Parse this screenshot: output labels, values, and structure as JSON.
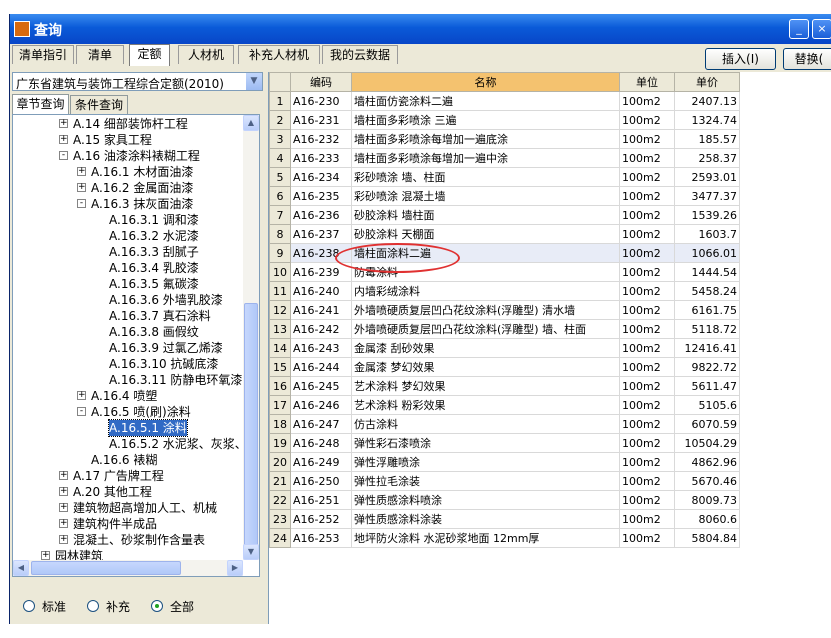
{
  "window": {
    "title": "查询",
    "controls": {
      "minimize": "_",
      "close": "×"
    }
  },
  "tabs": [
    {
      "label": "清单指引",
      "active": false
    },
    {
      "label": "清单",
      "active": false
    },
    {
      "label": "定额",
      "active": true
    },
    {
      "label": "人材机",
      "active": false
    },
    {
      "label": "补充人材机",
      "active": false
    },
    {
      "label": "我的云数据",
      "active": false
    }
  ],
  "actions": {
    "insert": "插入(I)",
    "replace": "替换("
  },
  "library": {
    "selected": "广东省建筑与装饰工程综合定额(2010)"
  },
  "subtabs": [
    {
      "label": "章节查询",
      "active": true
    },
    {
      "label": "条件查询",
      "active": false
    }
  ],
  "tree": [
    {
      "depth": 1,
      "exp": "+",
      "label": "A.14 细部装饰杆工程"
    },
    {
      "depth": 1,
      "exp": "+",
      "label": "A.15 家具工程"
    },
    {
      "depth": 1,
      "exp": "-",
      "label": "A.16 油漆涂料裱糊工程"
    },
    {
      "depth": 2,
      "exp": "+",
      "label": "A.16.1 木材面油漆"
    },
    {
      "depth": 2,
      "exp": "+",
      "label": "A.16.2 金属面油漆"
    },
    {
      "depth": 2,
      "exp": "-",
      "label": "A.16.3 抹灰面油漆"
    },
    {
      "depth": 3,
      "exp": "",
      "label": "A.16.3.1 调和漆"
    },
    {
      "depth": 3,
      "exp": "",
      "label": "A.16.3.2 水泥漆"
    },
    {
      "depth": 3,
      "exp": "",
      "label": "A.16.3.3 刮腻子"
    },
    {
      "depth": 3,
      "exp": "",
      "label": "A.16.3.4 乳胶漆"
    },
    {
      "depth": 3,
      "exp": "",
      "label": "A.16.3.5 氟碳漆"
    },
    {
      "depth": 3,
      "exp": "",
      "label": "A.16.3.6 外墙乳胶漆"
    },
    {
      "depth": 3,
      "exp": "",
      "label": "A.16.3.7 真石涂料"
    },
    {
      "depth": 3,
      "exp": "",
      "label": "A.16.3.8 画假纹"
    },
    {
      "depth": 3,
      "exp": "",
      "label": "A.16.3.9 过氯乙烯漆"
    },
    {
      "depth": 3,
      "exp": "",
      "label": "A.16.3.10 抗碱底漆"
    },
    {
      "depth": 3,
      "exp": "",
      "label": "A.16.3.11 防静电环氧漆"
    },
    {
      "depth": 2,
      "exp": "+",
      "label": "A.16.4 喷塑"
    },
    {
      "depth": 2,
      "exp": "-",
      "label": "A.16.5 喷(刷)涂料"
    },
    {
      "depth": 3,
      "exp": "",
      "label": "A.16.5.1 涂料",
      "selected": true
    },
    {
      "depth": 3,
      "exp": "",
      "label": "A.16.5.2 水泥浆、灰浆、大"
    },
    {
      "depth": 2,
      "exp": "",
      "label": "A.16.6 裱糊"
    },
    {
      "depth": 1,
      "exp": "+",
      "label": "A.17 广告牌工程"
    },
    {
      "depth": 1,
      "exp": "+",
      "label": "A.20 其他工程"
    },
    {
      "depth": 1,
      "exp": "+",
      "label": "建筑物超高增加人工、机械"
    },
    {
      "depth": 1,
      "exp": "+",
      "label": "建筑构件半成品"
    },
    {
      "depth": 1,
      "exp": "+",
      "label": "混凝土、砂浆制作含量表"
    },
    {
      "depth": 0,
      "exp": "+",
      "label": "园林建筑"
    }
  ],
  "filters": [
    {
      "label": "标准",
      "checked": false
    },
    {
      "label": "补充",
      "checked": false
    },
    {
      "label": "全部",
      "checked": true
    }
  ],
  "table": {
    "headers": {
      "code": "编码",
      "name": "名称",
      "unit": "单位",
      "price": "单价"
    },
    "rows": [
      {
        "n": "1",
        "code": "A16-230",
        "name": "墙柱面仿瓷涂料二遍",
        "unit": "100m2",
        "price": "2407.13"
      },
      {
        "n": "2",
        "code": "A16-231",
        "name": "墙柱面多彩喷涂 三遍",
        "unit": "100m2",
        "price": "1324.74"
      },
      {
        "n": "3",
        "code": "A16-232",
        "name": "墙柱面多彩喷涂每增加一遍底涂",
        "unit": "100m2",
        "price": "185.57"
      },
      {
        "n": "4",
        "code": "A16-233",
        "name": "墙柱面多彩喷涂每增加一遍中涂",
        "unit": "100m2",
        "price": "258.37"
      },
      {
        "n": "5",
        "code": "A16-234",
        "name": "彩砂喷涂 墙、柱面",
        "unit": "100m2",
        "price": "2593.01"
      },
      {
        "n": "6",
        "code": "A16-235",
        "name": "彩砂喷涂 混凝土墙",
        "unit": "100m2",
        "price": "3477.37"
      },
      {
        "n": "7",
        "code": "A16-236",
        "name": "砂胶涂料 墙柱面",
        "unit": "100m2",
        "price": "1539.26"
      },
      {
        "n": "8",
        "code": "A16-237",
        "name": "砂胶涂料 天棚面",
        "unit": "100m2",
        "price": "1603.7"
      },
      {
        "n": "9",
        "code": "A16-238",
        "name": "墙柱面涂料二遍",
        "unit": "100m2",
        "price": "1066.01",
        "highlight": true
      },
      {
        "n": "10",
        "code": "A16-239",
        "name": "防霉涂料",
        "unit": "100m2",
        "price": "1444.54"
      },
      {
        "n": "11",
        "code": "A16-240",
        "name": "内墙彩绒涂料",
        "unit": "100m2",
        "price": "5458.24"
      },
      {
        "n": "12",
        "code": "A16-241",
        "name": "外墙喷硬质复层凹凸花纹涂料(浮雕型) 清水墙",
        "unit": "100m2",
        "price": "6161.75"
      },
      {
        "n": "13",
        "code": "A16-242",
        "name": "外墙喷硬质复层凹凸花纹涂料(浮雕型) 墙、柱面",
        "unit": "100m2",
        "price": "5118.72"
      },
      {
        "n": "14",
        "code": "A16-243",
        "name": "金属漆 刮砂效果",
        "unit": "100m2",
        "price": "12416.41"
      },
      {
        "n": "15",
        "code": "A16-244",
        "name": "金属漆 梦幻效果",
        "unit": "100m2",
        "price": "9822.72"
      },
      {
        "n": "16",
        "code": "A16-245",
        "name": "艺术涂料 梦幻效果",
        "unit": "100m2",
        "price": "5611.47"
      },
      {
        "n": "17",
        "code": "A16-246",
        "name": "艺术涂料 粉彩效果",
        "unit": "100m2",
        "price": "5105.6"
      },
      {
        "n": "18",
        "code": "A16-247",
        "name": "仿古涂料",
        "unit": "100m2",
        "price": "6070.59"
      },
      {
        "n": "19",
        "code": "A16-248",
        "name": "弹性彩石漆喷涂",
        "unit": "100m2",
        "price": "10504.29"
      },
      {
        "n": "20",
        "code": "A16-249",
        "name": "弹性浮雕喷涂",
        "unit": "100m2",
        "price": "4862.96"
      },
      {
        "n": "21",
        "code": "A16-250",
        "name": "弹性拉毛涂装",
        "unit": "100m2",
        "price": "5670.46"
      },
      {
        "n": "22",
        "code": "A16-251",
        "name": "弹性质感涂料喷涂",
        "unit": "100m2",
        "price": "8009.73"
      },
      {
        "n": "23",
        "code": "A16-252",
        "name": "弹性质感涂料涂装",
        "unit": "100m2",
        "price": "8060.6"
      },
      {
        "n": "24",
        "code": "A16-253",
        "name": "地坪防火涂料 水泥砂浆地面 12mm厚",
        "unit": "100m2",
        "price": "5804.84"
      }
    ]
  },
  "colors": {
    "titlebar": "#0a5ad8",
    "name_header": "#f4c26f",
    "annotation_circle": "#e03131",
    "selection": "#316ac5"
  }
}
